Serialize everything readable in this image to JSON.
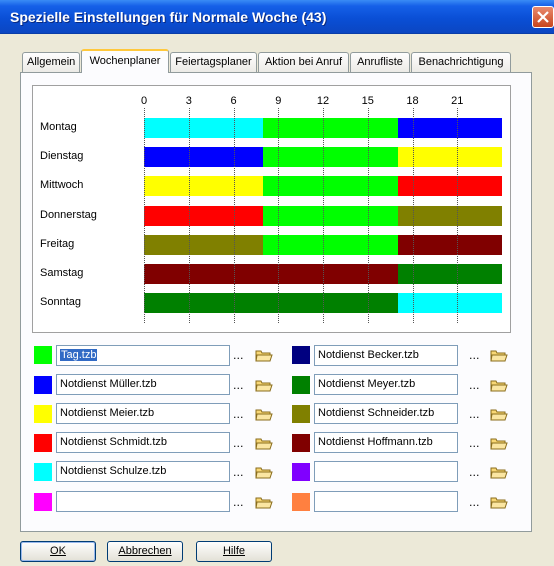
{
  "window": {
    "title": "Spezielle Einstellungen für Normale Woche (43)"
  },
  "tabs": [
    {
      "label": "Allgemein",
      "active": false
    },
    {
      "label": "Wochenplaner",
      "active": true
    },
    {
      "label": "Feiertagsplaner",
      "active": false
    },
    {
      "label": "Aktion bei Anruf",
      "active": false
    },
    {
      "label": "Anrufliste",
      "active": false
    },
    {
      "label": "Benachrichtigung",
      "active": false
    }
  ],
  "planner": {
    "hour_ticks": [
      "0",
      "3",
      "6",
      "9",
      "12",
      "15",
      "18",
      "21"
    ],
    "days": [
      {
        "label": "Montag",
        "segments": [
          {
            "start": 0,
            "end": 8,
            "color": "#00ffff"
          },
          {
            "start": 8,
            "end": 17,
            "color": "#00ff00"
          },
          {
            "start": 17,
            "end": 24,
            "color": "#0000ff"
          }
        ]
      },
      {
        "label": "Dienstag",
        "segments": [
          {
            "start": 0,
            "end": 8,
            "color": "#0000ff"
          },
          {
            "start": 8,
            "end": 17,
            "color": "#00ff00"
          },
          {
            "start": 17,
            "end": 24,
            "color": "#ffff00"
          }
        ]
      },
      {
        "label": "Mittwoch",
        "segments": [
          {
            "start": 0,
            "end": 8,
            "color": "#ffff00"
          },
          {
            "start": 8,
            "end": 17,
            "color": "#00ff00"
          },
          {
            "start": 17,
            "end": 24,
            "color": "#ff0000"
          }
        ]
      },
      {
        "label": "Donnerstag",
        "segments": [
          {
            "start": 0,
            "end": 8,
            "color": "#ff0000"
          },
          {
            "start": 8,
            "end": 17,
            "color": "#00ff00"
          },
          {
            "start": 17,
            "end": 24,
            "color": "#808000"
          }
        ]
      },
      {
        "label": "Freitag",
        "segments": [
          {
            "start": 0,
            "end": 8,
            "color": "#808000"
          },
          {
            "start": 8,
            "end": 17,
            "color": "#00ff00"
          },
          {
            "start": 17,
            "end": 24,
            "color": "#800000"
          }
        ]
      },
      {
        "label": "Samstag",
        "segments": [
          {
            "start": 0,
            "end": 17,
            "color": "#800000"
          },
          {
            "start": 17,
            "end": 24,
            "color": "#008000"
          }
        ]
      },
      {
        "label": "Sonntag",
        "segments": [
          {
            "start": 0,
            "end": 17,
            "color": "#008000"
          },
          {
            "start": 17,
            "end": 24,
            "color": "#00ffff"
          }
        ]
      }
    ]
  },
  "profiles_left": [
    {
      "color": "#00ff00",
      "value": "Tag.tzb",
      "selected": true
    },
    {
      "color": "#0000ff",
      "value": "Notdienst Müller.tzb"
    },
    {
      "color": "#ffff00",
      "value": "Notdienst Meier.tzb"
    },
    {
      "color": "#ff0000",
      "value": "Notdienst Schmidt.tzb"
    },
    {
      "color": "#00ffff",
      "value": "Notdienst Schulze.tzb"
    },
    {
      "color": "#ff00ff",
      "value": ""
    }
  ],
  "profiles_right": [
    {
      "color": "#000080",
      "value": "Notdienst Becker.tzb"
    },
    {
      "color": "#008000",
      "value": "Notdienst Meyer.tzb"
    },
    {
      "color": "#808000",
      "value": "Notdienst Schneider.tzb"
    },
    {
      "color": "#800000",
      "value": "Notdienst Hoffmann.tzb"
    },
    {
      "color": "#8000ff",
      "value": ""
    },
    {
      "color": "#ff8040",
      "value": ""
    }
  ],
  "browse_label": "...",
  "buttons": {
    "ok": "OK",
    "cancel": "Abbrechen",
    "help": "Hilfe"
  }
}
